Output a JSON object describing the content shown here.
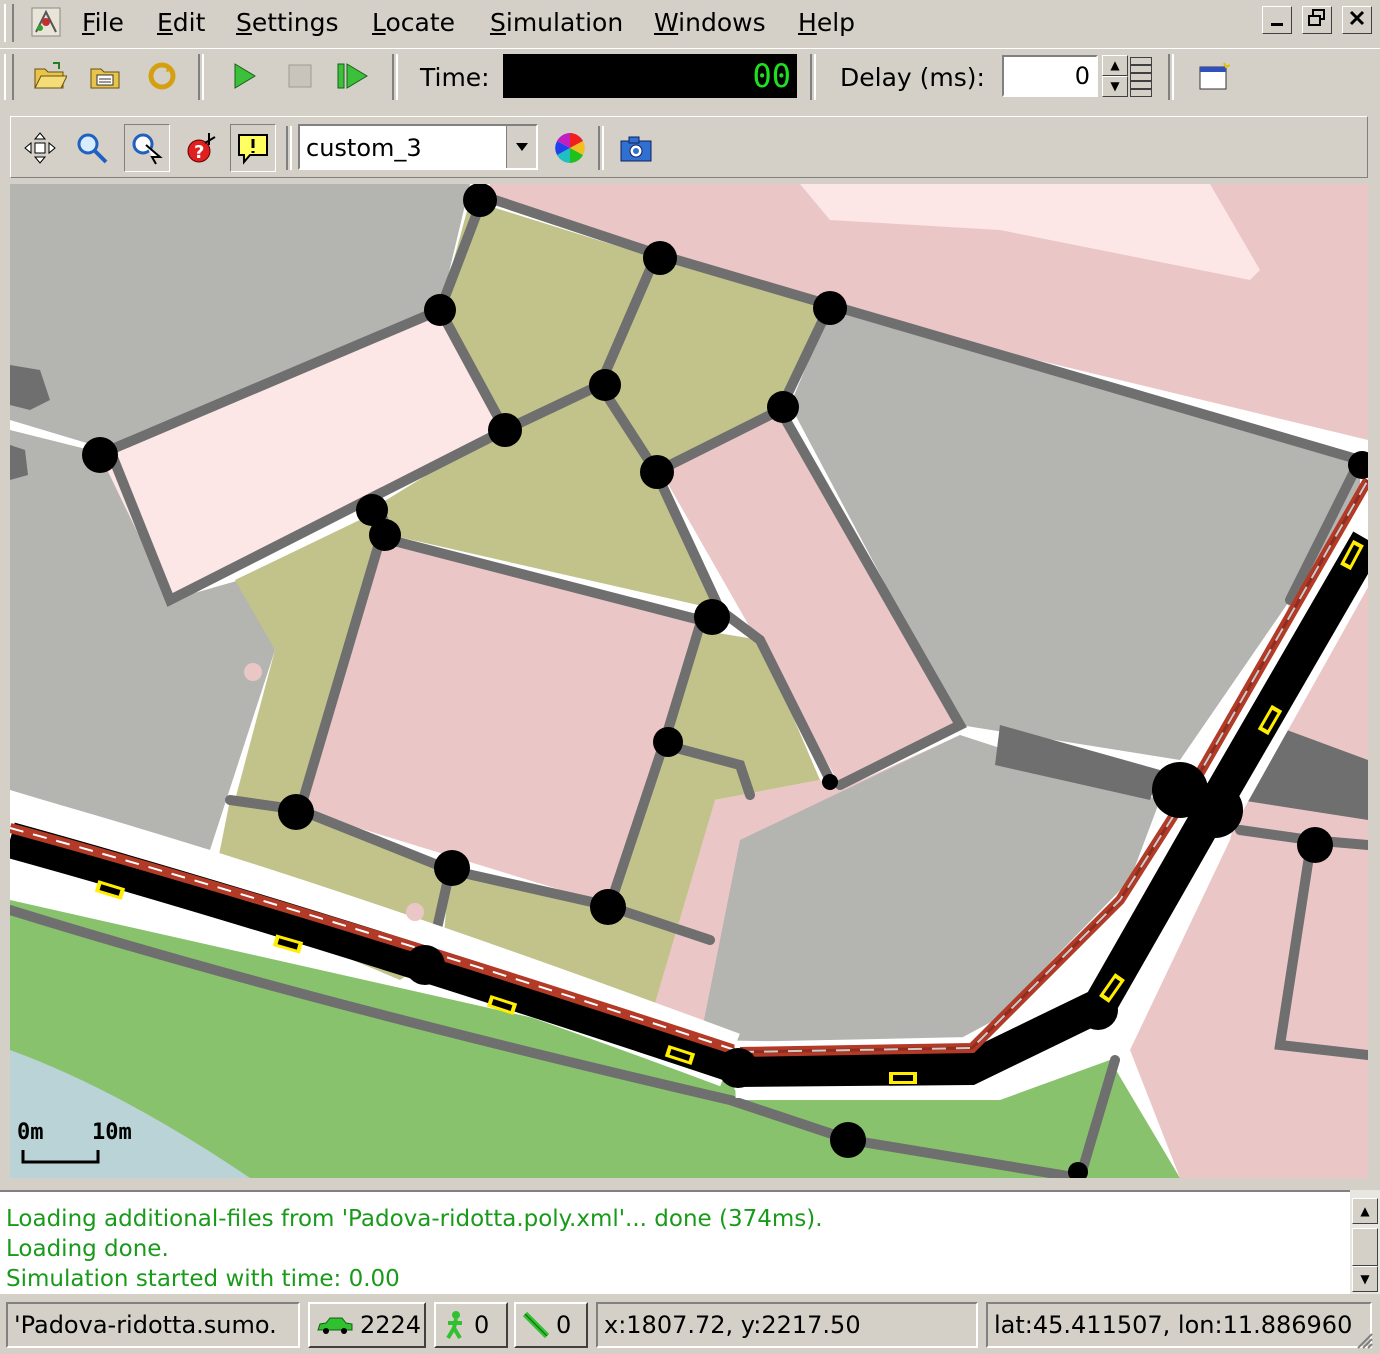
{
  "menubar": {
    "items": [
      {
        "label": "File"
      },
      {
        "label": "Edit"
      },
      {
        "label": "Settings"
      },
      {
        "label": "Locate"
      },
      {
        "label": "Simulation"
      },
      {
        "label": "Windows"
      },
      {
        "label": "Help"
      }
    ]
  },
  "toolbar": {
    "time_label": "Time:",
    "time_value": "00",
    "delay_label": "Delay (ms):",
    "delay_value": "0"
  },
  "view_toolbar": {
    "scheme_value": "custom_3"
  },
  "map": {
    "scale_start": "0m",
    "scale_end": "10m",
    "colors": {
      "building_gray": "#b4b4b0",
      "building_pink": "#ebc6c6",
      "building_light_pink": "#fce6e6",
      "park_olive": "#c2c38a",
      "grass_green": "#88c26c",
      "water": "#b9d3d6",
      "road": "#000000",
      "footway": "#6f6f6f",
      "bike_lane": "#b33a27",
      "vehicle": "#ffee00"
    }
  },
  "log": {
    "lines": [
      "Loading additional-files from 'Padova-ridotta.poly.xml'... done (374ms).",
      "Loading done.",
      "Simulation started with time: 0.00"
    ]
  },
  "statusbar": {
    "config_file": "'Padova-ridotta.sumo.",
    "vehicles": "2224",
    "persons": "0",
    "containers": "0",
    "xy": "x:1807.72, y:2217.50",
    "latlon": "lat:45.411507, lon:11.886960"
  }
}
